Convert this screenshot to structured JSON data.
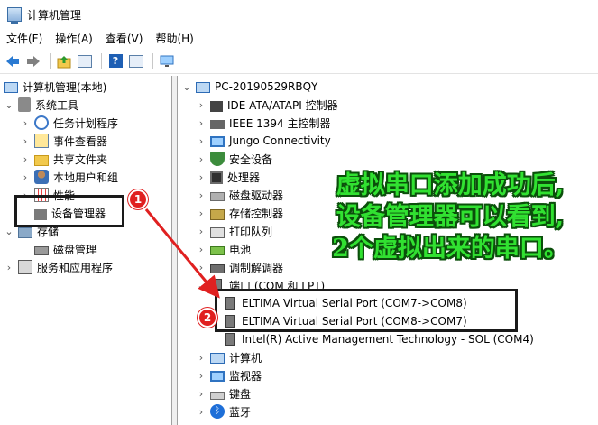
{
  "window": {
    "title": "计算机管理"
  },
  "menu": [
    "文件(F)",
    "操作(A)",
    "查看(V)",
    "帮助(H)"
  ],
  "left_tree": [
    {
      "label": "计算机管理(本地)",
      "icon": "computer-management-icon"
    },
    {
      "label": "系统工具",
      "icon": "system-tools-icon"
    },
    {
      "label": "任务计划程序",
      "icon": "task-scheduler-icon"
    },
    {
      "label": "事件查看器",
      "icon": "event-viewer-icon"
    },
    {
      "label": "共享文件夹",
      "icon": "shared-folder-icon"
    },
    {
      "label": "本地用户和组",
      "icon": "local-users-icon"
    },
    {
      "label": "性能",
      "icon": "performance-icon"
    },
    {
      "label": "设备管理器",
      "icon": "device-manager-icon"
    },
    {
      "label": "存储",
      "icon": "storage-icon"
    },
    {
      "label": "磁盘管理",
      "icon": "disk-management-icon"
    },
    {
      "label": "服务和应用程序",
      "icon": "services-icon"
    }
  ],
  "right_tree": {
    "root": "PC-20190529RBQY",
    "categories": [
      "IDE ATA/ATAPI 控制器",
      "IEEE 1394 主控制器",
      "Jungo Connectivity",
      "安全设备",
      "处理器",
      "磁盘驱动器",
      "存储控制器",
      "打印队列",
      "电池",
      "调制解调器",
      "端口 (COM 和 LPT)"
    ],
    "ports": [
      "ELTIMA Virtual Serial Port (COM7->COM8)",
      "ELTIMA Virtual Serial Port (COM8->COM7)",
      "Intel(R) Active Management Technology - SOL (COM4)"
    ],
    "categories_after": [
      "计算机",
      "监视器",
      "键盘",
      "蓝牙"
    ]
  },
  "badges": {
    "one": "1",
    "two": "2"
  },
  "annotation": {
    "line1": "虚拟串口添加成功后,",
    "line2": "设备管理器可以看到,",
    "line3": "2个虚拟出来的串口。"
  },
  "colors": {
    "badge": "#e02020",
    "annotation_text": "#31e131",
    "annotation_outline": "#0b4f0b"
  }
}
